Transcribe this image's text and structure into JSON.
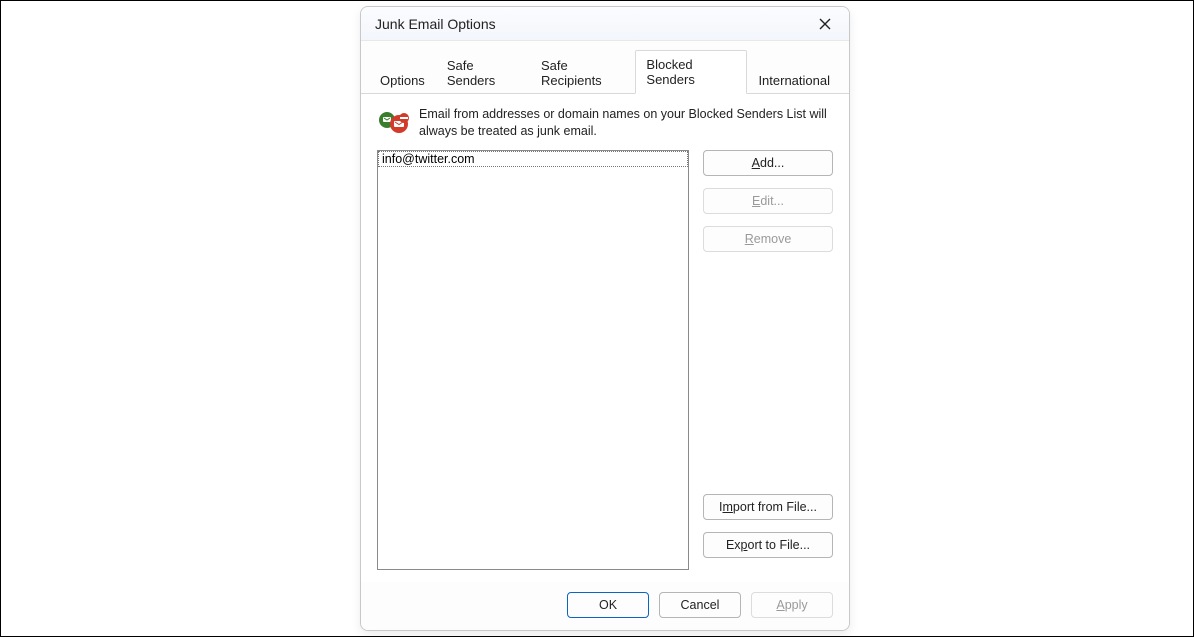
{
  "dialog": {
    "title": "Junk Email Options"
  },
  "tabs": [
    {
      "label": "Options",
      "active": false
    },
    {
      "label": "Safe Senders",
      "active": false
    },
    {
      "label": "Safe Recipients",
      "active": false
    },
    {
      "label": "Blocked Senders",
      "active": true
    },
    {
      "label": "International",
      "active": false
    }
  ],
  "description": "Email from addresses or domain names on your Blocked Senders List will always be treated as junk email.",
  "blocked_list": [
    "info@twitter.com"
  ],
  "buttons": {
    "add": "Add...",
    "edit": "Edit...",
    "remove": "Remove",
    "import": "Import from File...",
    "export": "Export to File...",
    "ok": "OK",
    "cancel": "Cancel",
    "apply": "Apply"
  }
}
